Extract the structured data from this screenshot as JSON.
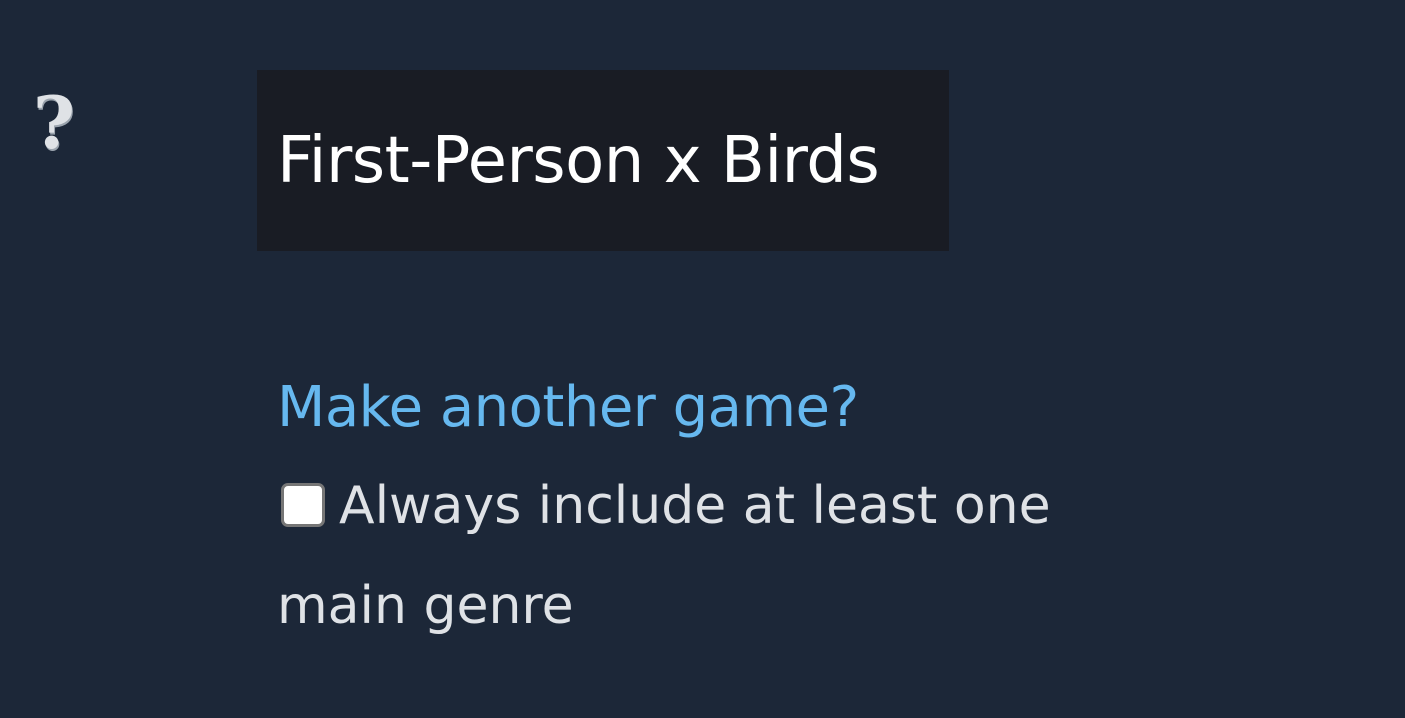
{
  "help": {
    "icon": "question-mark-icon",
    "glyph": "?"
  },
  "game": {
    "title": "First-Person x Birds"
  },
  "actions": {
    "make_another": "Make another game?"
  },
  "options": {
    "include_main_genre": {
      "checked": false,
      "label_line1": "Always include at least one",
      "label_line2": "main genre"
    }
  },
  "colors": {
    "background": "#1c2738",
    "title_box": "#191c24",
    "link": "#66b8ef",
    "text": "#dfe2e6"
  }
}
